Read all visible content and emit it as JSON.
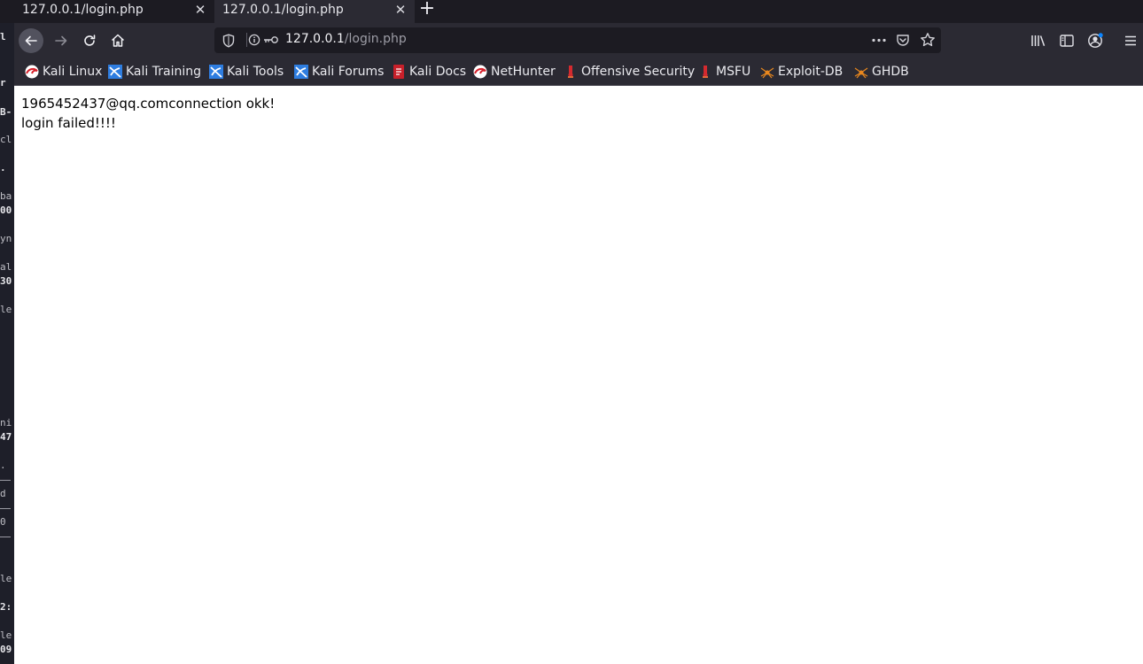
{
  "tabs": [
    {
      "title": "127.0.0.1/login.php",
      "active": false
    },
    {
      "title": "127.0.0.1/login.php",
      "active": true
    }
  ],
  "tab_close_glyph": "✕",
  "new_tab_glyph": "+",
  "url": {
    "host": "127.0.0.1",
    "path": "/login.php"
  },
  "bookmarks": [
    {
      "label": "Kali Linux",
      "icon": "kali-dragon-icon"
    },
    {
      "label": "Kali Training",
      "icon": "kali-training-icon"
    },
    {
      "label": "Kali Tools",
      "icon": "kali-tools-icon"
    },
    {
      "label": "Kali Forums",
      "icon": "kali-forums-icon"
    },
    {
      "label": "Kali Docs",
      "icon": "kali-docs-icon"
    },
    {
      "label": "NetHunter",
      "icon": "nethunter-icon"
    },
    {
      "label": "Offensive Security",
      "icon": "offsec-icon"
    },
    {
      "label": "MSFU",
      "icon": "msfu-icon"
    },
    {
      "label": "Exploit-DB",
      "icon": "exploit-db-spider-icon"
    },
    {
      "label": "GHDB",
      "icon": "ghdb-spider-icon"
    }
  ],
  "page": {
    "line1": "1965452437@qq.comconnection okk!",
    "line2": "login failed!!!!"
  },
  "left_strip": [
    "l",
    "r",
    "B-",
    "cl",
    ".",
    "ba",
    "00",
    "yn",
    "al",
    "30",
    "le",
    "ni",
    "47",
    ".",
    "d",
    "0",
    "le",
    "2:",
    "le",
    "09"
  ],
  "colors": {
    "accent": "#0a84ff",
    "toolbar": "#2b2a33",
    "tabbar": "#1c1b22",
    "content_bg": "#ffffff"
  }
}
